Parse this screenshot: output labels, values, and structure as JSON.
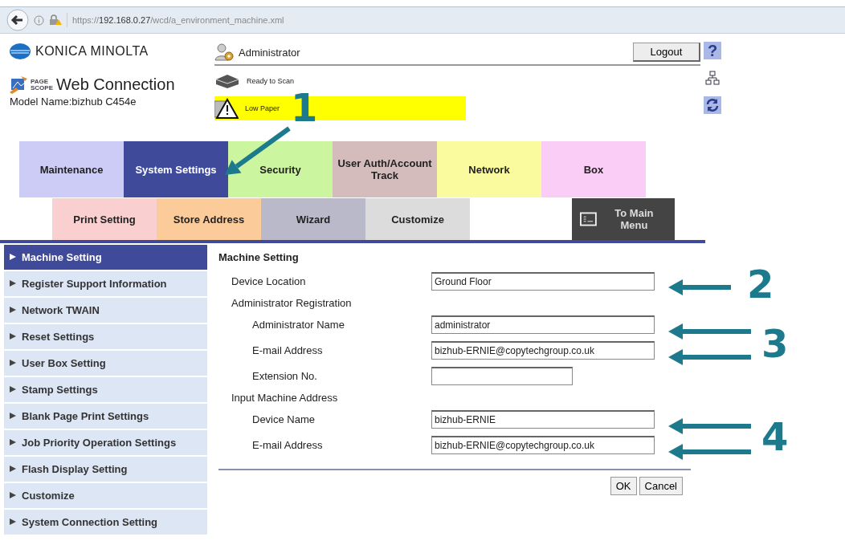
{
  "browser": {
    "url": "https://**192.168.0.27**/wcd/a_environment_machine.xml"
  },
  "header": {
    "brand": "KONICA MINOLTA",
    "product_mark": "PAGE SCOPE",
    "product": "Web Connection",
    "model": "Model Name:bizhub C454e",
    "user": "Administrator",
    "logout": "Logout",
    "help": "?",
    "status": [
      {
        "kind": "ready",
        "text": "Ready to Scan"
      },
      {
        "kind": "warning",
        "text": "Low Paper"
      }
    ]
  },
  "tabs": [
    {
      "label": "Maintenance",
      "color": "#ccccf6",
      "selected": false
    },
    {
      "label": "System Settings",
      "color": "#3f4a9a",
      "selected": true
    },
    {
      "label": "Security",
      "color": "#ccf5a0",
      "selected": false
    },
    {
      "label": "User Auth/Account Track",
      "color": "#d4bcbc",
      "selected": false
    },
    {
      "label": "Network",
      "color": "#fafa9e",
      "selected": false
    },
    {
      "label": "Box",
      "color": "#f9cdf5",
      "selected": false
    }
  ],
  "subtabs": [
    {
      "kind": "tab",
      "label": "Print Setting",
      "color": "#f9cfcf"
    },
    {
      "kind": "tab",
      "label": "Store Address",
      "color": "#fbcb99"
    },
    {
      "kind": "tab",
      "label": "Wizard",
      "color": "#b9b9c9"
    },
    {
      "kind": "tab",
      "label": "Customize",
      "color": "#dcdcdc"
    },
    {
      "kind": "menu",
      "label": "To Main Menu",
      "color": "#444444"
    }
  ],
  "sidebar": {
    "items": [
      {
        "label": "Machine Setting",
        "selected": true
      },
      {
        "label": "Register Support Information",
        "selected": false
      },
      {
        "label": "Network TWAIN",
        "selected": false
      },
      {
        "label": "Reset Settings",
        "selected": false
      },
      {
        "label": "User Box Setting",
        "selected": false
      },
      {
        "label": "Stamp Settings",
        "selected": false
      },
      {
        "label": "Blank Page Print Settings",
        "selected": false
      },
      {
        "label": "Job Priority Operation Settings",
        "selected": false
      },
      {
        "label": "Flash Display Setting",
        "selected": false
      },
      {
        "label": "Customize",
        "selected": false
      },
      {
        "label": "System Connection Setting",
        "selected": false
      }
    ]
  },
  "form": {
    "title": "Machine Setting",
    "items": [
      {
        "kind": "field",
        "label": "Device Location",
        "value": "Ground Floor"
      },
      {
        "kind": "section",
        "label": "Administrator Registration",
        "children": [
          {
            "kind": "field",
            "label": "Administrator Name",
            "value": "administrator"
          },
          {
            "kind": "field",
            "label": "E-mail Address",
            "value": "bizhub-ERNIE@copytechgroup.co.uk"
          },
          {
            "kind": "short",
            "label": "Extension No."
          }
        ]
      },
      {
        "kind": "section",
        "label": "Input Machine Address",
        "children": [
          {
            "kind": "field",
            "label": "Device Name",
            "value": "bizhub-ERNIE"
          },
          {
            "kind": "field",
            "label": "E-mail Address",
            "value": "bizhub-ERNIE@copytechgroup.co.uk"
          }
        ]
      }
    ],
    "buttons": [
      "OK",
      "Cancel"
    ]
  },
  "annotations": [
    {
      "label": "1"
    },
    {
      "label": "2"
    },
    {
      "label": "3"
    },
    {
      "label": "4"
    }
  ]
}
